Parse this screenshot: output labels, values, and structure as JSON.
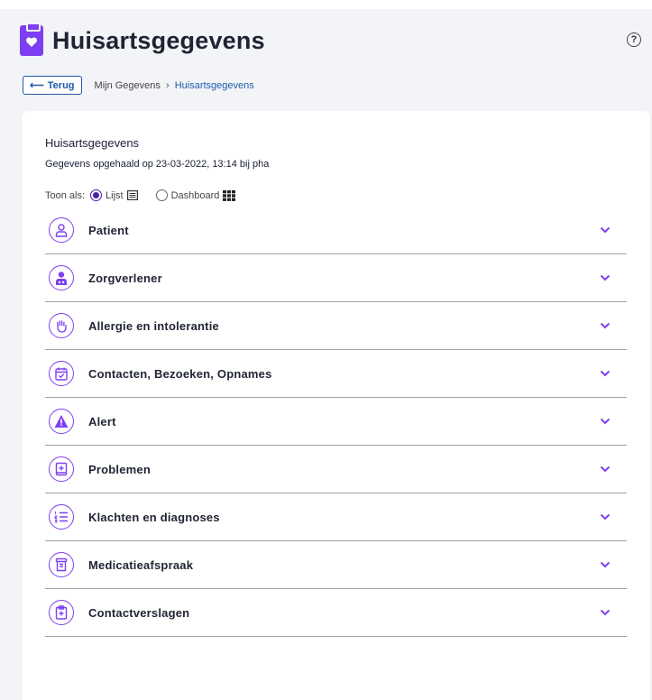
{
  "header": {
    "title": "Huisartsgegevens",
    "help_label": "?"
  },
  "breadcrumb": {
    "back_label": "Terug",
    "root": "Mijn Gegevens",
    "separator": "›",
    "current": "Huisartsgegevens"
  },
  "card": {
    "title": "Huisartsgegevens",
    "subtitle": "Gegevens opgehaald op 23-03-2022, 13:14 bij pha",
    "view_label": "Toon als:",
    "view_options": [
      {
        "label": "Lijst",
        "selected": true,
        "icon": "list-icon"
      },
      {
        "label": "Dashboard",
        "selected": false,
        "icon": "grid-icon"
      }
    ]
  },
  "sections": [
    {
      "label": "Patient",
      "icon": "person-icon"
    },
    {
      "label": "Zorgverlener",
      "icon": "doctor-icon"
    },
    {
      "label": "Allergie en intolerantie",
      "icon": "hand-icon"
    },
    {
      "label": "Contacten, Bezoeken, Opnames",
      "icon": "calendar-check-icon"
    },
    {
      "label": "Alert",
      "icon": "warning-icon"
    },
    {
      "label": "Problemen",
      "icon": "medical-book-icon"
    },
    {
      "label": "Klachten en diagnoses",
      "icon": "numbered-list-icon"
    },
    {
      "label": "Medicatieafspraak",
      "icon": "medicine-jar-icon"
    },
    {
      "label": "Contactverslagen",
      "icon": "medical-clipboard-icon"
    }
  ],
  "colors": {
    "accent": "#7e3ff2",
    "link": "#1e5aa8",
    "radio": "#4a1fa8"
  }
}
